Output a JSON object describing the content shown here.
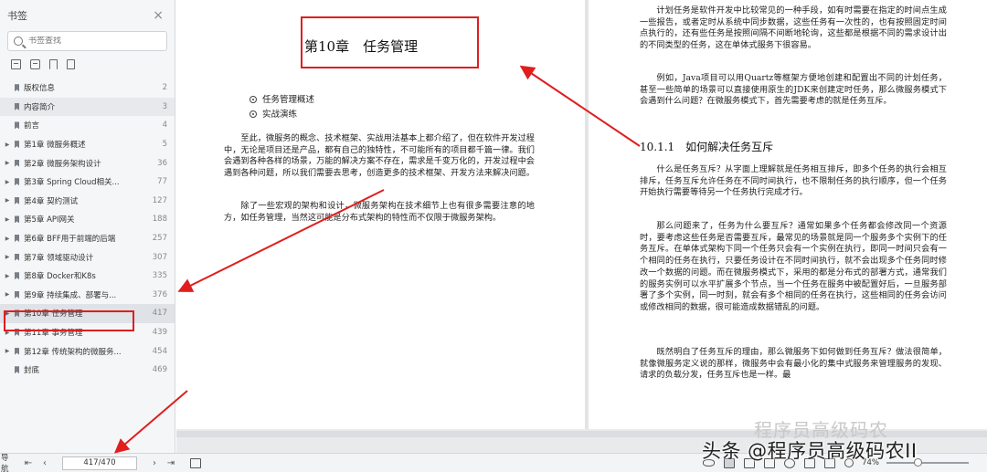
{
  "sidebar": {
    "title": "书签",
    "close_icon": "×",
    "search_placeholder": "书签查找",
    "items": [
      {
        "label": "版权信息",
        "page": "2",
        "arrow": false
      },
      {
        "label": "内容简介",
        "page": "3",
        "arrow": false
      },
      {
        "label": "前言",
        "page": "4",
        "arrow": false
      },
      {
        "label": "第1章 微服务概述",
        "page": "5",
        "arrow": true
      },
      {
        "label": "第2章 微服务架构设计",
        "page": "36",
        "arrow": true
      },
      {
        "label": "第3章 Spring Cloud相关...",
        "page": "77",
        "arrow": true
      },
      {
        "label": "第4章 契约测试",
        "page": "127",
        "arrow": true
      },
      {
        "label": "第5章 API网关",
        "page": "188",
        "arrow": true
      },
      {
        "label": "第6章 BFF用于前端的后端",
        "page": "257",
        "arrow": true
      },
      {
        "label": "第7章 领域驱动设计",
        "page": "307",
        "arrow": true
      },
      {
        "label": "第8章 Docker和K8s",
        "page": "335",
        "arrow": true
      },
      {
        "label": "第9章 持续集成、部署与...",
        "page": "376",
        "arrow": true
      },
      {
        "label": "第10章 任务管理",
        "page": "417",
        "arrow": true
      },
      {
        "label": "第11章 事务管理",
        "page": "439",
        "arrow": true
      },
      {
        "label": "第12章 传统架构的微服务...",
        "page": "454",
        "arrow": true
      },
      {
        "label": "封底",
        "page": "469",
        "arrow": false
      }
    ]
  },
  "left_page": {
    "chapter_title": "第10章　任务管理",
    "toc": [
      "任务管理概述",
      "实战演练"
    ],
    "para1": "至此，微服务的概念、技术框架、实战用法基本上都介绍了，但在软件开发过程中，无论是项目还是产品，都有自己的独特性，不可能所有的项目都千篇一律。我们会遇到各种各样的场景，万能的解决方案不存在，需求是千变万化的，开发过程中会遇到各种问题，所以我们需要去思考，创造更多的技术框架、开发方法来解决问题。",
    "para2": "除了一些宏观的架构和设计，微服务架构在技术细节上也有很多需要注意的地方，如任务管理，当然这可能是分布式架构的特性而不仅限于微服务架构。"
  },
  "right_page": {
    "para1": "计划任务是软件开发中比较常见的一种手段，如有时需要在指定的时间点生成一些报告，或者定时从系统中同步数据，这些任务有一次性的，也有按照固定时间点执行的，还有些任务是按照间隔不间断地轮询，这些都是根据不同的需求设计出的不同类型的任务，这在单体式服务下很容易。",
    "para2": "例如，Java项目可以用Quartz等框架方便地创建和配置出不同的计划任务，甚至一些简单的场景可以直接使用原生的JDK来创建定时任务，那么微服务模式下会遇到什么问题？在微服务模式下，首先需要考虑的就是任务互斥。",
    "section_title": "10.1.1　如何解决任务互斥",
    "para3": "什么是任务互斥？从字面上理解就是任务相互排斥，即多个任务的执行会相互排斥，任务互斥允许任务在不同时间执行，也不限制任务的执行顺序，但一个任务开始执行需要等待另一个任务执行完成才行。",
    "para4": "那么问题来了，任务为什么要互斥？通常如果多个任务都会修改同一个资源时，要考虑这些任务是否需要互斥，最常见的场景就是同一个服务多个实例下的任务互斥。在单体式架构下同一个任务只会有一个实例在执行，即同一时间只会有一个相同的任务在执行，只要任务设计在不同时间执行，就不会出现多个任务同时修改一个数据的问题。而在微服务模式下，采用的都是分布式的部署方式，通常我们的服务实例可以水平扩展多个节点，当一个任务在服务中被配置好后，一旦服务部署了多个实例，同一时刻，就会有多个相同的任务在执行，这些相同的任务会访问或修改相同的数据，很可能造成数据错乱的问题。",
    "para5": "既然明白了任务互斥的理由，那么微服务下如何做到任务互斥？做法很简单，就像微服务定义说的那样，微服务中会有最小化的集中式服务来管理服务的发现、请求的负载分发，任务互斥也是一样。最"
  },
  "statusbar": {
    "nav_label": "导航",
    "page_indicator": "417/470",
    "zoom": "74%",
    "zoom_level_fraction": 0.74
  },
  "watermark": {
    "top_text": "程序员高级码农",
    "main_text": "头条 @程序员高级码农II"
  },
  "colors": {
    "highlight_red": "#e01e1e",
    "sidebar_bg": "#f5f6f7",
    "active_item_bg": "#dfe2e6"
  }
}
